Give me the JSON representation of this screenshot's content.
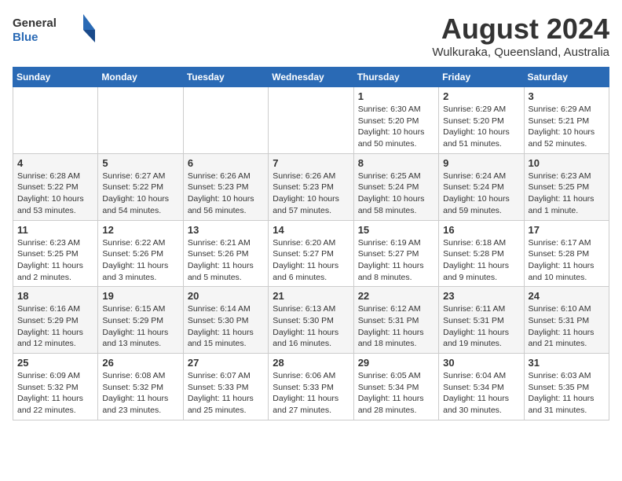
{
  "logo": {
    "general": "General",
    "blue": "Blue"
  },
  "title": "August 2024",
  "location": "Wulkuraka, Queensland, Australia",
  "weekdays": [
    "Sunday",
    "Monday",
    "Tuesday",
    "Wednesday",
    "Thursday",
    "Friday",
    "Saturday"
  ],
  "weeks": [
    [
      {
        "day": "",
        "info": ""
      },
      {
        "day": "",
        "info": ""
      },
      {
        "day": "",
        "info": ""
      },
      {
        "day": "",
        "info": ""
      },
      {
        "day": "1",
        "info": "Sunrise: 6:30 AM\nSunset: 5:20 PM\nDaylight: 10 hours\nand 50 minutes."
      },
      {
        "day": "2",
        "info": "Sunrise: 6:29 AM\nSunset: 5:20 PM\nDaylight: 10 hours\nand 51 minutes."
      },
      {
        "day": "3",
        "info": "Sunrise: 6:29 AM\nSunset: 5:21 PM\nDaylight: 10 hours\nand 52 minutes."
      }
    ],
    [
      {
        "day": "4",
        "info": "Sunrise: 6:28 AM\nSunset: 5:22 PM\nDaylight: 10 hours\nand 53 minutes."
      },
      {
        "day": "5",
        "info": "Sunrise: 6:27 AM\nSunset: 5:22 PM\nDaylight: 10 hours\nand 54 minutes."
      },
      {
        "day": "6",
        "info": "Sunrise: 6:26 AM\nSunset: 5:23 PM\nDaylight: 10 hours\nand 56 minutes."
      },
      {
        "day": "7",
        "info": "Sunrise: 6:26 AM\nSunset: 5:23 PM\nDaylight: 10 hours\nand 57 minutes."
      },
      {
        "day": "8",
        "info": "Sunrise: 6:25 AM\nSunset: 5:24 PM\nDaylight: 10 hours\nand 58 minutes."
      },
      {
        "day": "9",
        "info": "Sunrise: 6:24 AM\nSunset: 5:24 PM\nDaylight: 10 hours\nand 59 minutes."
      },
      {
        "day": "10",
        "info": "Sunrise: 6:23 AM\nSunset: 5:25 PM\nDaylight: 11 hours\nand 1 minute."
      }
    ],
    [
      {
        "day": "11",
        "info": "Sunrise: 6:23 AM\nSunset: 5:25 PM\nDaylight: 11 hours\nand 2 minutes."
      },
      {
        "day": "12",
        "info": "Sunrise: 6:22 AM\nSunset: 5:26 PM\nDaylight: 11 hours\nand 3 minutes."
      },
      {
        "day": "13",
        "info": "Sunrise: 6:21 AM\nSunset: 5:26 PM\nDaylight: 11 hours\nand 5 minutes."
      },
      {
        "day": "14",
        "info": "Sunrise: 6:20 AM\nSunset: 5:27 PM\nDaylight: 11 hours\nand 6 minutes."
      },
      {
        "day": "15",
        "info": "Sunrise: 6:19 AM\nSunset: 5:27 PM\nDaylight: 11 hours\nand 8 minutes."
      },
      {
        "day": "16",
        "info": "Sunrise: 6:18 AM\nSunset: 5:28 PM\nDaylight: 11 hours\nand 9 minutes."
      },
      {
        "day": "17",
        "info": "Sunrise: 6:17 AM\nSunset: 5:28 PM\nDaylight: 11 hours\nand 10 minutes."
      }
    ],
    [
      {
        "day": "18",
        "info": "Sunrise: 6:16 AM\nSunset: 5:29 PM\nDaylight: 11 hours\nand 12 minutes."
      },
      {
        "day": "19",
        "info": "Sunrise: 6:15 AM\nSunset: 5:29 PM\nDaylight: 11 hours\nand 13 minutes."
      },
      {
        "day": "20",
        "info": "Sunrise: 6:14 AM\nSunset: 5:30 PM\nDaylight: 11 hours\nand 15 minutes."
      },
      {
        "day": "21",
        "info": "Sunrise: 6:13 AM\nSunset: 5:30 PM\nDaylight: 11 hours\nand 16 minutes."
      },
      {
        "day": "22",
        "info": "Sunrise: 6:12 AM\nSunset: 5:31 PM\nDaylight: 11 hours\nand 18 minutes."
      },
      {
        "day": "23",
        "info": "Sunrise: 6:11 AM\nSunset: 5:31 PM\nDaylight: 11 hours\nand 19 minutes."
      },
      {
        "day": "24",
        "info": "Sunrise: 6:10 AM\nSunset: 5:31 PM\nDaylight: 11 hours\nand 21 minutes."
      }
    ],
    [
      {
        "day": "25",
        "info": "Sunrise: 6:09 AM\nSunset: 5:32 PM\nDaylight: 11 hours\nand 22 minutes."
      },
      {
        "day": "26",
        "info": "Sunrise: 6:08 AM\nSunset: 5:32 PM\nDaylight: 11 hours\nand 23 minutes."
      },
      {
        "day": "27",
        "info": "Sunrise: 6:07 AM\nSunset: 5:33 PM\nDaylight: 11 hours\nand 25 minutes."
      },
      {
        "day": "28",
        "info": "Sunrise: 6:06 AM\nSunset: 5:33 PM\nDaylight: 11 hours\nand 27 minutes."
      },
      {
        "day": "29",
        "info": "Sunrise: 6:05 AM\nSunset: 5:34 PM\nDaylight: 11 hours\nand 28 minutes."
      },
      {
        "day": "30",
        "info": "Sunrise: 6:04 AM\nSunset: 5:34 PM\nDaylight: 11 hours\nand 30 minutes."
      },
      {
        "day": "31",
        "info": "Sunrise: 6:03 AM\nSunset: 5:35 PM\nDaylight: 11 hours\nand 31 minutes."
      }
    ]
  ]
}
